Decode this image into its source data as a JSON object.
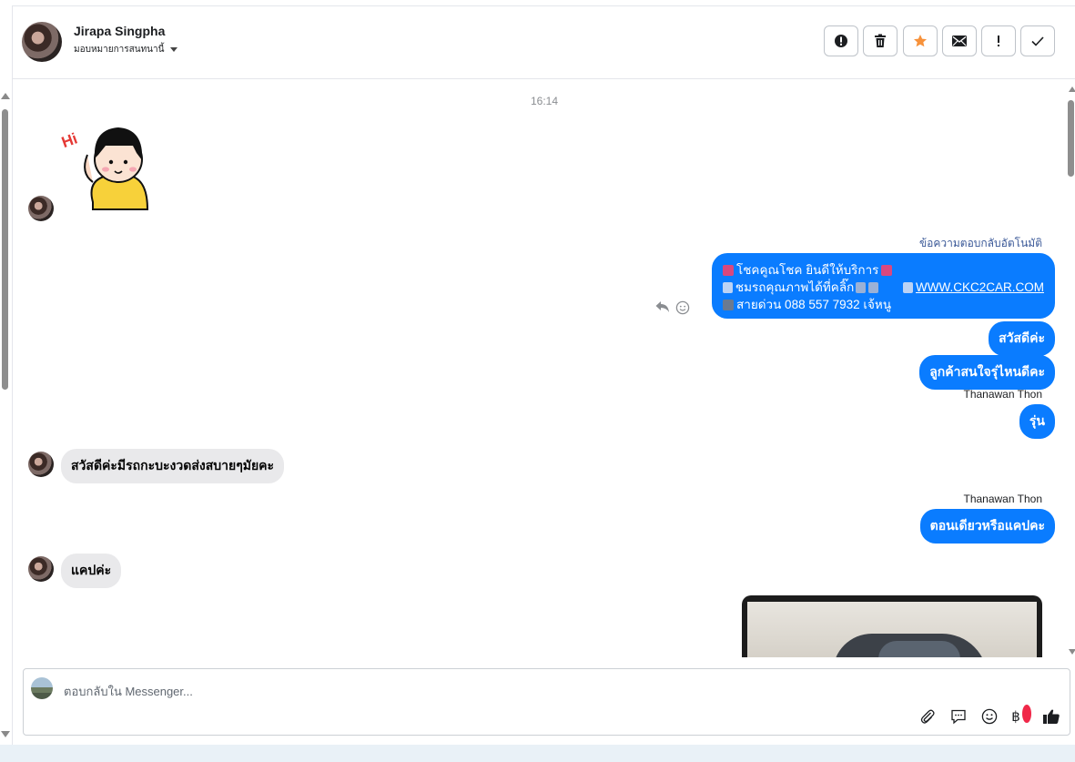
{
  "header": {
    "contact_name": "Jirapa Singpha",
    "assign_label": "มอบหมายการสนทนานี้",
    "toolbar": [
      {
        "name": "alert-circle-icon"
      },
      {
        "name": "trash-icon"
      },
      {
        "name": "star-icon",
        "color": "#f7923b"
      },
      {
        "name": "mail-icon"
      },
      {
        "name": "exclamation-icon"
      },
      {
        "name": "check-icon"
      }
    ]
  },
  "chat": {
    "timestamp": "16:14",
    "auto_reply_label": "ข้อความตอบกลับอัตโนมัติ",
    "auto_reply": {
      "line1": "โชคคูณโชค ยินดีให้บริการ",
      "line2_a": "ชมรถคุณภาพได้ที่คลิ๊ก",
      "line2_link": "WWW.CKC2CAR.COM",
      "line3": "สายด่วน 088 557 7932 เจ้หนู"
    },
    "messages": {
      "out1": "สวัสดีค่ะ",
      "out2": "ลูกค้าสนใจรุ่ไหนดีคะ",
      "sender1": "Thanawan Thon",
      "out3": "รุ่น",
      "in1": "สวัสดีค่ะมีรถกะบะงวดส่งสบายๆมัยคะ",
      "sender2": "Thanawan Thon",
      "out4": "ตอนเดียวหรือแคปคะ",
      "in2": "แคปค่ะ"
    }
  },
  "composer": {
    "placeholder": "ตอบกลับใน Messenger...",
    "currency_symbol": "฿"
  },
  "colors": {
    "accent": "#0a7cff",
    "incoming_bubble": "#e9e9eb"
  }
}
